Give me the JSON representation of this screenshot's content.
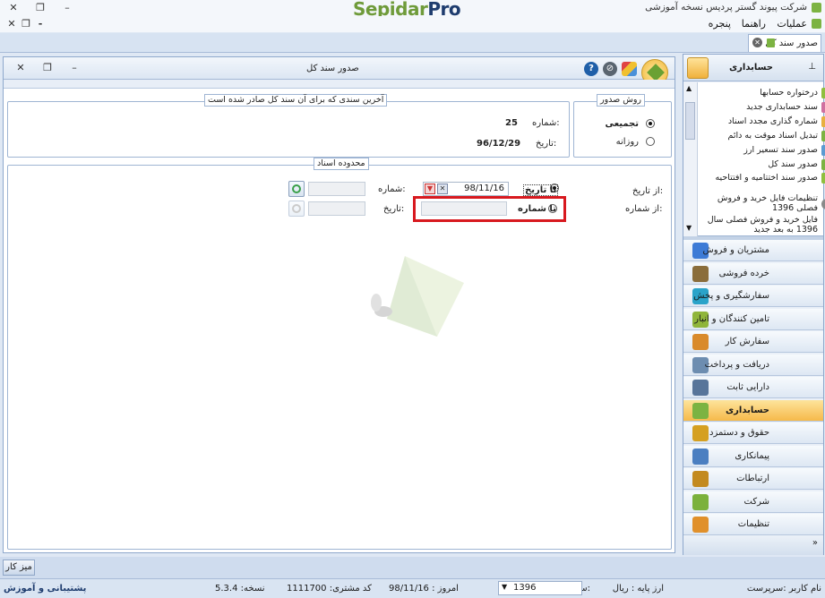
{
  "window": {
    "app_title": "شرکت پیوند گستر پردیس نسخه آموزشی",
    "logo_part1": "Sepidar",
    "logo_part2": "Pro"
  },
  "menu": {
    "items": [
      "عملیات",
      "راهنما",
      "پنجره"
    ]
  },
  "doc_tab": {
    "label": "صدور سند کل"
  },
  "form": {
    "title": "صدور سند کل",
    "method_group": {
      "legend": "روش صدور",
      "options": [
        "تجمیعی",
        "روزانه"
      ],
      "selected": 0
    },
    "last_doc_group": {
      "legend": "آخرین سندی که برای آن سند کل صادر شده است",
      "number_label": "شماره:",
      "number_value": "25",
      "date_label": "تاریخ:",
      "date_value": "96/12/29"
    },
    "range_group": {
      "legend": "محدوده اسناد",
      "from_date_label": "از تاریخ:",
      "to_date_option": "تا تاریخ",
      "to_date_value": "98/11/16",
      "number_label": "شماره:",
      "from_number_label": "از شماره:",
      "to_number_option": "تا شماره",
      "date_label": "تاریخ:"
    }
  },
  "side_panel": {
    "title": "حسابداری",
    "items": [
      "درختواره حسابها",
      "سند حسابداری جدید",
      "شماره گذاری مجدد اسناد",
      "تبدیل اسناد موقت به دائم",
      "صدور سند تسعیر ارز",
      "صدور سند کل",
      "صدور سند اختتامیه و افتتاحیه",
      "تنظیمات فایل خرید و فروش فصلی 1396",
      "فایل خرید و فروش فصلی سال 1396 به بعد جدید"
    ],
    "nav": [
      "مشتریان و فروش",
      "خرده فروشی",
      "سفارشگیری و پخش",
      "تامین کنندگان و انبار",
      "سفارش کار",
      "دریافت و پرداخت",
      "دارایی ثابت",
      "حسابداری",
      "حقوق و دستمزد",
      "پیمانکاری",
      "ارتباطات",
      "شرکت",
      "تنظیمات"
    ],
    "active_nav": "حسابداری",
    "nav_colors": [
      "#3d7bd6",
      "#8a6d3b",
      "#2aa3c9",
      "#8fb53a",
      "#d98a2b",
      "#6d8db0",
      "#58759a",
      "#7cb342",
      "#d5a021",
      "#4b7fc1",
      "#c38a1f",
      "#7bb13c",
      "#e0902b"
    ]
  },
  "taskbar": {
    "mizkar": "میز کار"
  },
  "status": {
    "user": "نام کاربر :سرپرست",
    "base_currency": "ارز پایه : ریال",
    "fiscal_year_label": "سال مالی:",
    "fiscal_year": "1396",
    "today": "امروز : 98/11/16",
    "customer_code": "کد مشتری: 1111700",
    "version": "نسخه: 5.3.4",
    "support": "پشتیبانی و آموزش"
  }
}
